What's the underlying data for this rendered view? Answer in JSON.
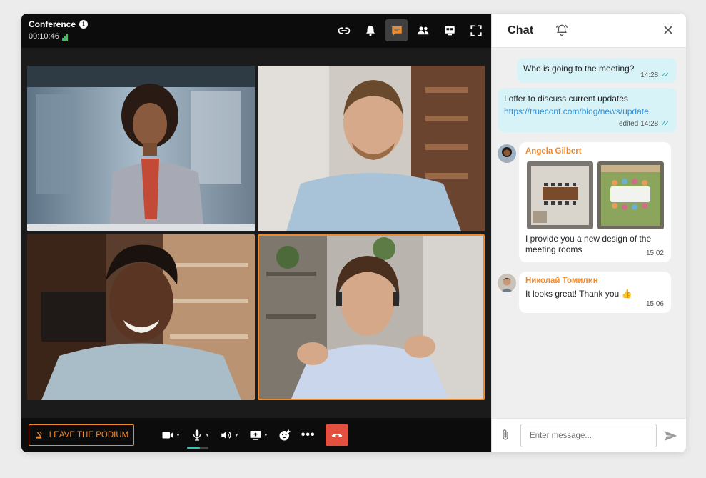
{
  "conference": {
    "title": "Conference",
    "info_icon": "i",
    "elapsed": "00:10:46",
    "signal_icon": "signal-strength-icon"
  },
  "toolbar_top": {
    "icons": [
      "link-icon",
      "bell-icon",
      "chat-icon",
      "participants-icon",
      "layout-icon",
      "fullscreen-icon"
    ],
    "active": "chat-icon"
  },
  "participants": [
    {
      "name": "participant-1",
      "highlighted": false
    },
    {
      "name": "participant-2",
      "highlighted": false
    },
    {
      "name": "participant-3",
      "highlighted": false
    },
    {
      "name": "participant-4",
      "highlighted": true
    }
  ],
  "bottom": {
    "leave_label": "LEAVE THE PODIUM",
    "controls": [
      "camera-icon",
      "microphone-icon",
      "speaker-icon",
      "screen-share-icon",
      "reactions-icon",
      "more-icon",
      "hangup-icon"
    ],
    "more_label": "•••",
    "mic_level": 0.6
  },
  "chat": {
    "title": "Chat",
    "messages": [
      {
        "direction": "out",
        "text": "Who is going to the meeting?",
        "time": "14:28"
      },
      {
        "direction": "out",
        "text": "I offer to discuss current updates",
        "link": "https://trueconf.com/blog/news/update",
        "time": "14:28",
        "edited_label": "edited"
      },
      {
        "direction": "in",
        "sender": "Angela Gilbert",
        "text": "I provide you a new design of the meeting rooms",
        "time": "15:02"
      },
      {
        "direction": "in",
        "sender": "Николай Томилин",
        "text": "It looks great! Thank you 👍",
        "time": "15:06"
      }
    ],
    "input_placeholder": "Enter message..."
  },
  "colors": {
    "accent": "#ef8a2c",
    "outgoing_bubble": "#d7f3f7",
    "link": "#2f8fd8",
    "hangup": "#e3503e",
    "signal": "#37c15a"
  }
}
